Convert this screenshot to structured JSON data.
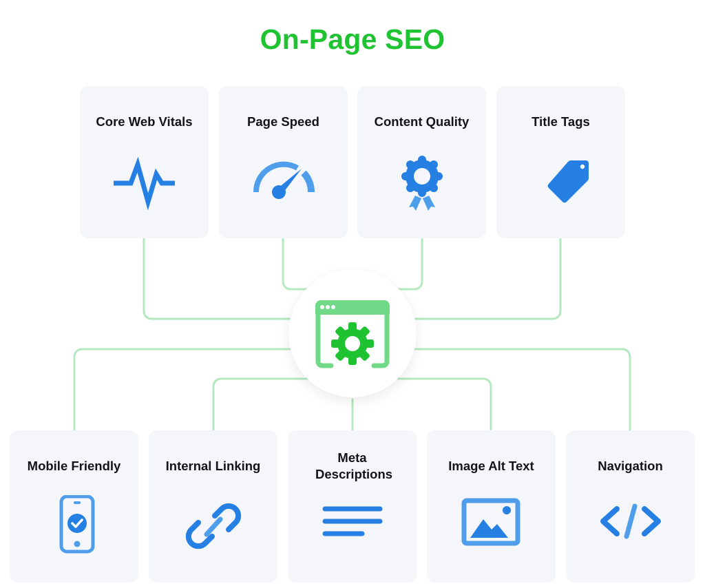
{
  "title": "On-Page SEO",
  "colors": {
    "title": "#1fc230",
    "icon_primary": "#2680e4",
    "icon_secondary": "#4f9eec",
    "connector": "#b4e8bf",
    "hub_gear": "#1fc230",
    "hub_window": "#6fd987",
    "card_bg": "#f4f6fa"
  },
  "hub": {
    "icon": "settings-window-icon"
  },
  "top_items": [
    {
      "label": "Core Web Vitals",
      "icon": "heartbeat-icon"
    },
    {
      "label": "Page Speed",
      "icon": "speedometer-icon"
    },
    {
      "label": "Content Quality",
      "icon": "award-badge-icon"
    },
    {
      "label": "Title Tags",
      "icon": "tag-icon"
    }
  ],
  "bottom_items": [
    {
      "label": "Mobile Friendly",
      "icon": "mobile-check-icon"
    },
    {
      "label": "Internal Linking",
      "icon": "link-icon"
    },
    {
      "label": "Meta Descriptions",
      "icon": "text-lines-icon"
    },
    {
      "label": "Image Alt Text",
      "icon": "image-icon"
    },
    {
      "label": "Navigation",
      "icon": "code-icon"
    }
  ]
}
